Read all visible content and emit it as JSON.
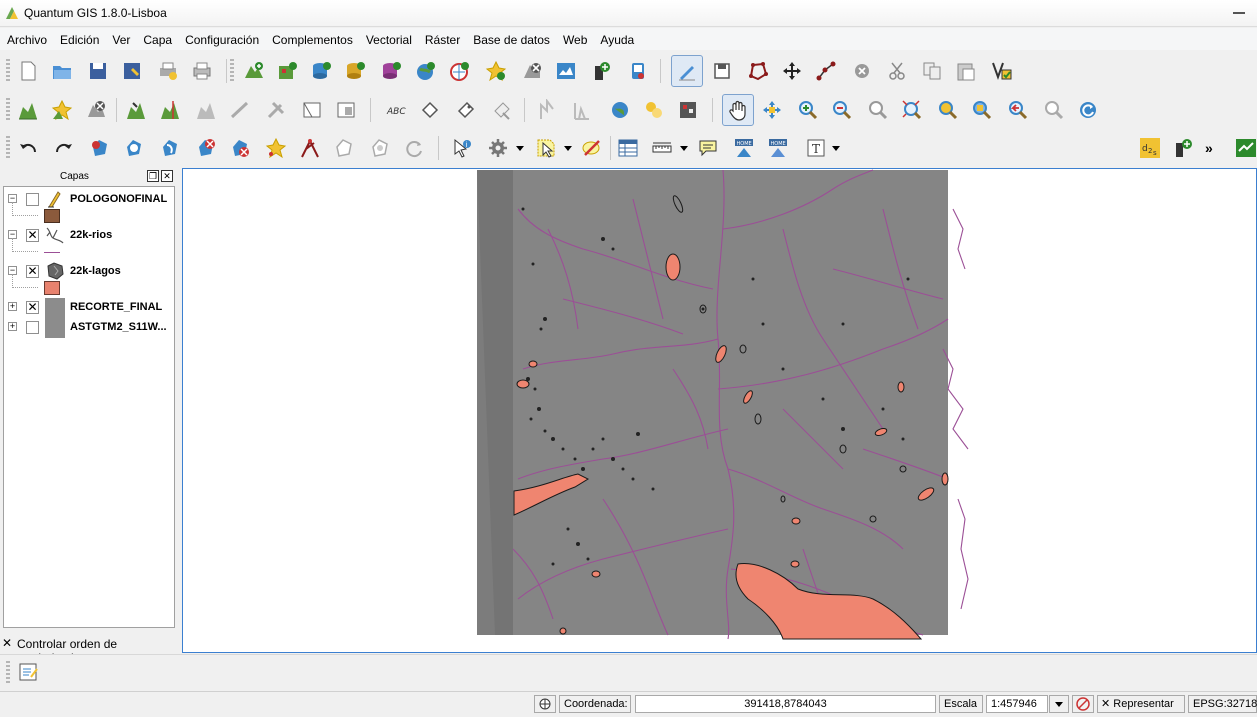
{
  "window": {
    "title": "Quantum GIS 1.8.0-Lisboa"
  },
  "menu": [
    "Archivo",
    "Edición",
    "Ver",
    "Capa",
    "Configuración",
    "Complementos",
    "Vectorial",
    "Ráster",
    "Base de datos",
    "Web",
    "Ayuda"
  ],
  "toolbar1": [
    "new-project-icon",
    "open-project-icon",
    "save-project-icon",
    "save-as-icon",
    "print-composer-icon",
    "print-icon",
    "add-vector-layer-icon",
    "add-raster-layer-icon",
    "add-postgis-layer-icon",
    "add-spatialite-layer-icon",
    "add-mssql-layer-icon",
    "add-wms-layer-icon",
    "add-wfs-layer-icon",
    "add-delimited-text-icon",
    "remove-layer-icon",
    "new-shapefile-icon",
    "new-spatialite-icon",
    "gps-icon",
    "toggle-editing-icon",
    "save-edits-icon",
    "add-feature-icon",
    "move-feature-icon",
    "node-tool-icon",
    "delete-selected-icon",
    "cut-features-icon",
    "copy-features-icon",
    "paste-features-icon",
    "validate-icon"
  ],
  "toolbar2": [
    "add-ring-icon",
    "add-part-icon",
    "delete-ring-icon",
    "reshape-icon",
    "split-icon",
    "merge-icon",
    "offset-curve-icon",
    "simplify-icon",
    "rotate-icon",
    "label-icon",
    "move-label-icon",
    "rotate-label-icon",
    "change-label-icon",
    "pan-icon",
    "pan-to-selection-icon",
    "zoom-in-icon",
    "zoom-out-icon",
    "zoom-native-icon",
    "zoom-full-icon",
    "zoom-layer-icon",
    "zoom-selection-icon",
    "zoom-last-icon",
    "zoom-next-icon",
    "refresh-icon"
  ],
  "toolbar3": [
    "undo-icon",
    "redo-icon",
    "fill-ring-icon",
    "delete-part-icon",
    "reshape-features-icon",
    "split-parts-icon",
    "rotate-point-icon",
    "node-select-icon",
    "merge-attributes-icon",
    "identify-icon",
    "run-action-icon",
    "select-icon",
    "deselect-icon",
    "attribute-table-icon",
    "measure-icon",
    "map-tips-icon",
    "new-bookmark-icon",
    "show-bookmarks-icon",
    "text-annotation-icon",
    "d2s-icon",
    "plugin-add-icon",
    "overflow-icon",
    "python-icon"
  ],
  "layers_panel": {
    "title": "Capas",
    "layers": [
      {
        "name": "POLOGONOFINAL",
        "checked": false,
        "legend_color": "#8b5a3c"
      },
      {
        "name": "22k-rios",
        "checked": true,
        "legend_color": "#9b4f96"
      },
      {
        "name": "22k-lagos",
        "checked": true,
        "legend_color": "#e8826e"
      },
      {
        "name": "RECORTE_FINAL",
        "checked": true,
        "legend_color": "#8c8c8c"
      },
      {
        "name": "ASTGTM2_S11W...",
        "checked": false,
        "legend_color": "#8c8c8c"
      }
    ],
    "render_order_label": "Controlar orden de renderizado",
    "render_order_checked": true
  },
  "colors": {
    "raster": "#808080",
    "rivers": "#9b4f96",
    "lakes": "#ef8570",
    "canvas_border": "#3b7fd0"
  },
  "status": {
    "coord_label": "Coordenada:",
    "coord_value": "391418,8784043",
    "scale_label": "Escala",
    "scale_value": "1:457946",
    "render_label": "Representar",
    "render_checked": true,
    "crs": "EPSG:32718"
  }
}
